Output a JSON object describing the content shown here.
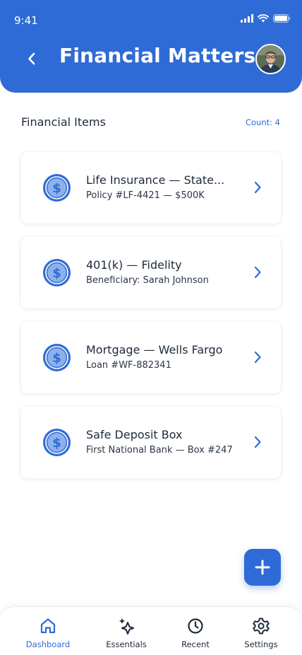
{
  "status_bar": {
    "time": "9:41"
  },
  "header": {
    "title": "Financial Matters"
  },
  "section": {
    "title": "Financial Items",
    "count": "Count: 4"
  },
  "items": [
    {
      "name": "Life Insurance — State...",
      "detail": "Policy #LF-4421 — $500K"
    },
    {
      "name": "401(k) — Fidelity",
      "detail": "Beneficiary: Sarah Johnson"
    },
    {
      "name": "Mortgage — Wells Fargo",
      "detail": "Loan #WF-882341"
    },
    {
      "name": "Safe Deposit Box",
      "detail": "First National Bank — Box #247"
    }
  ],
  "tabs": [
    {
      "label": "Dashboard",
      "icon": "home-icon",
      "active": true
    },
    {
      "label": "Essentials",
      "icon": "sparkle-icon",
      "active": false
    },
    {
      "label": "Recent",
      "icon": "clock-icon",
      "active": false
    },
    {
      "label": "Settings",
      "icon": "gear-icon",
      "active": false
    }
  ],
  "colors": {
    "primary": "#2f6bd6",
    "text": "#1e2a3b"
  }
}
